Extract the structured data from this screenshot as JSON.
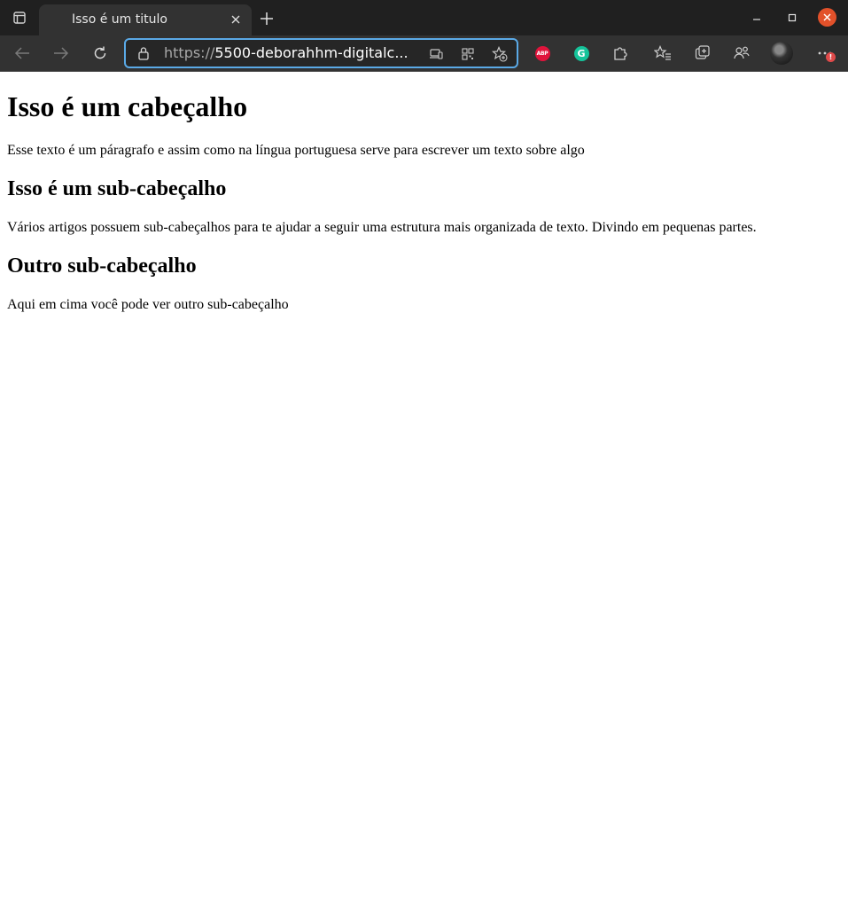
{
  "browser": {
    "tab": {
      "title": "Isso é um titulo"
    },
    "address_bar": {
      "scheme": "https://",
      "host": "5500-deborahhm-digitalc..."
    },
    "extensions": {
      "abp_label": "ABP",
      "grammarly_label": "G"
    },
    "menu_badge": "!"
  },
  "page": {
    "h1": "Isso é um cabeçalho",
    "p1": "Esse texto é um páragrafo e assim como na língua portuguesa serve para escrever um texto sobre algo",
    "h2_1": "Isso é um sub-cabeçalho",
    "p2": "Vários artigos possuem sub-cabeçalhos para te ajudar a seguir uma estrutura mais organizada de texto. Divindo em pequenas partes.",
    "h2_2": "Outro sub-cabeçalho",
    "p3": "Aqui em cima você pode ver outro sub-cabeçalho"
  },
  "colors": {
    "titlebar": "#202020",
    "toolbar": "#323232",
    "address_focus": "#5aa9e6",
    "close_button": "#e2512a"
  }
}
